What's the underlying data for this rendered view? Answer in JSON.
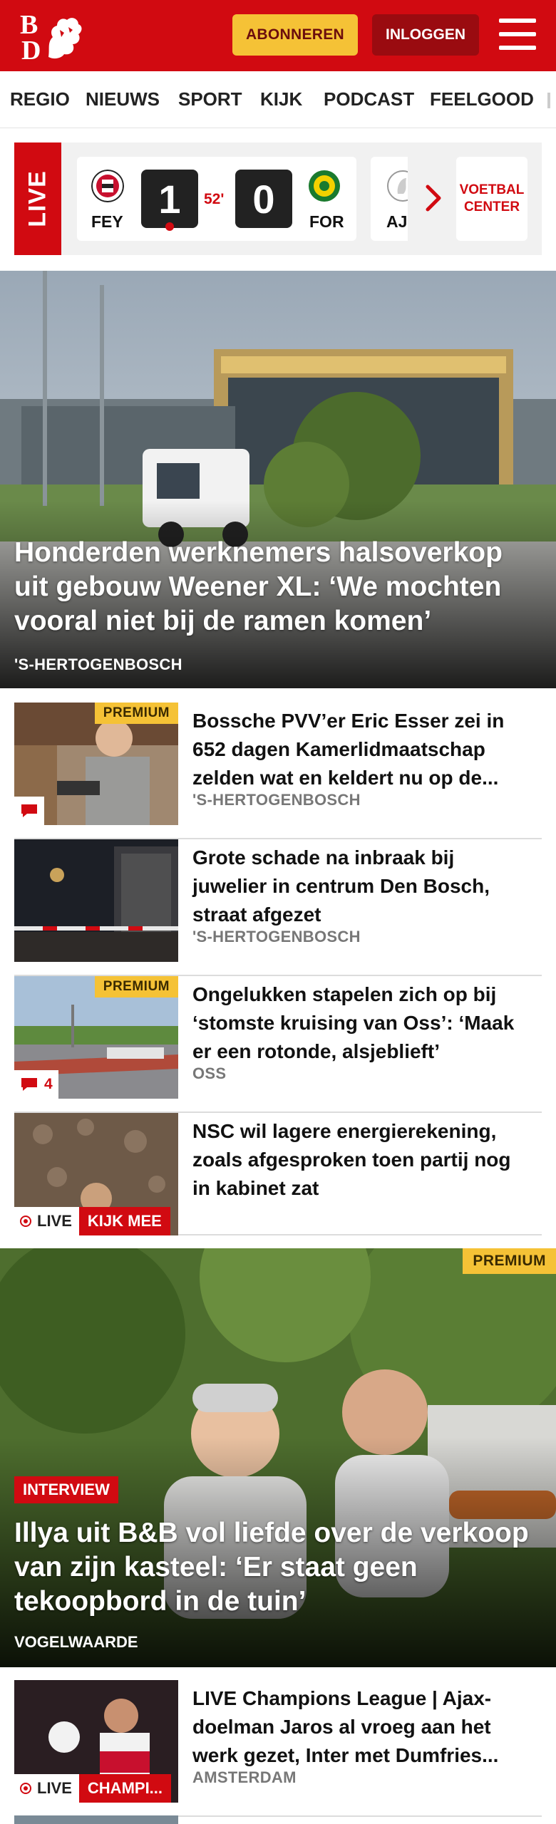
{
  "header": {
    "logo_letters": [
      "B",
      "D"
    ],
    "subscribe_label": "ABONNEREN",
    "login_label": "INLOGGEN",
    "menu_icon": "hamburger-icon"
  },
  "nav": {
    "items": [
      "REGIO",
      "NIEUWS",
      "SPORT",
      "KIJK",
      "PODCAST",
      "FEELGOOD"
    ]
  },
  "live_score": {
    "live_label": "LIVE",
    "home_code": "FEY",
    "home_score": "1",
    "minute": "52'",
    "away_score": "0",
    "away_code": "FOR",
    "next_code": "AJ",
    "center_label": "VOETBAL CENTER"
  },
  "hero": {
    "title": "Honderden werknemers halsoverkop uit gebouw Weener XL: ‘We mochten vooral niet bij de ramen komen’",
    "location": "'S-HERTOGENBOSCH"
  },
  "articles": [
    {
      "title": "Bossche PVV’er Eric Esser zei in 652 dagen Kamerlidmaatschap zelden wat en keldert nu op de...",
      "location": "'S-HERTOGENBOSCH",
      "premium": "PREMIUM",
      "comments": ""
    },
    {
      "title": "Grote schade na inbraak bij juwelier in centrum Den Bosch, straat afgezet",
      "location": "'S-HERTOGENBOSCH"
    },
    {
      "title": "Ongelukken stapelen zich op bij ‘stomste kruising van Oss’: ‘Maak er een rotonde, alsjeblieft’",
      "location": "OSS",
      "premium": "PREMIUM",
      "comments": "4"
    },
    {
      "title": "NSC wil lagere energierekening, zoals afgesproken toen partij nog in kabinet zat",
      "live_label": "LIVE",
      "live_action": "KIJK MEE"
    }
  ],
  "feature": {
    "premium": "PREMIUM",
    "tag": "INTERVIEW",
    "title": "Illya uit B&B vol liefde over de verkoop van zijn kasteel: ‘Er staat geen tekoopbord in de tuin’",
    "location": "VOGELWAARDE"
  },
  "article_bottom": {
    "title": "LIVE Champions League | Ajax-doelman Jaros al vroeg aan het werk gezet, Inter met Dumfries...",
    "location": "AMSTERDAM",
    "live_label": "LIVE",
    "live_action": "CHAMPI..."
  },
  "colors": {
    "brand_red": "#d10a11",
    "premium_yellow": "#f5c236",
    "login_dark_red": "#9a0b10"
  }
}
